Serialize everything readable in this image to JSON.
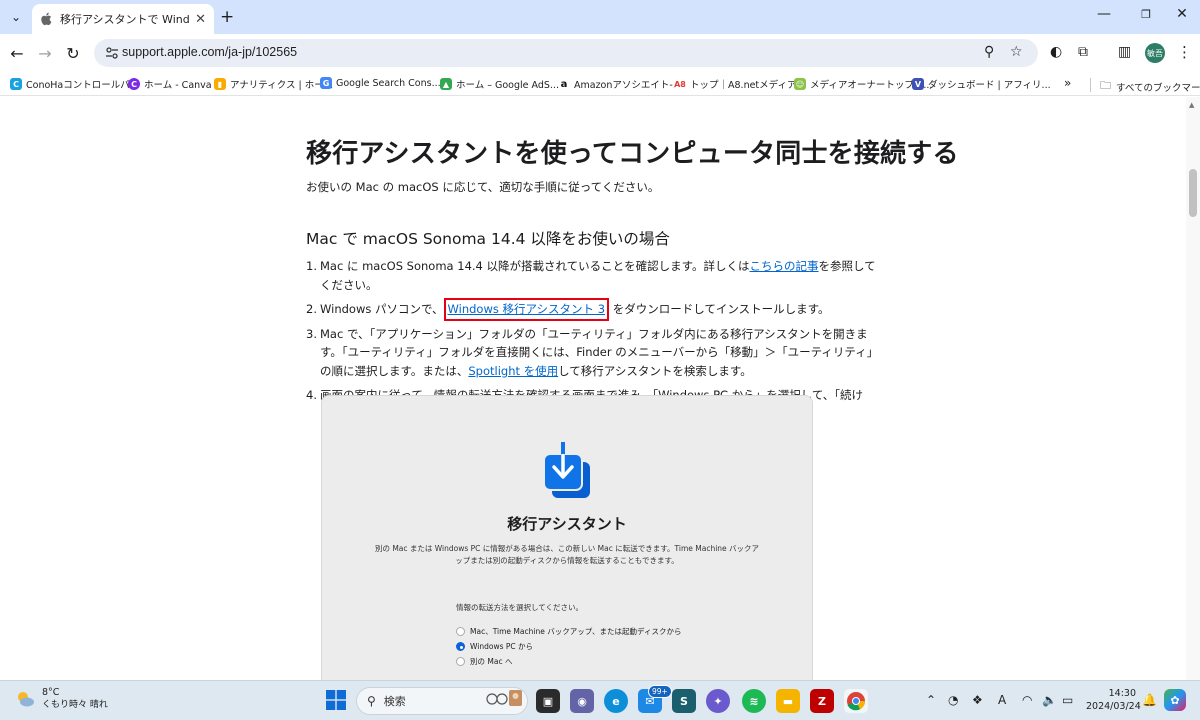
{
  "browser": {
    "tab_title": "移行アシスタントで Windows パソコン",
    "url": "support.apple.com/ja-jp/102565",
    "profile_label": "敏吾",
    "bookmarks": [
      {
        "label": "ConoHaコントロールパ...",
        "color": "#19a1e0"
      },
      {
        "label": "ホーム - Canva",
        "color": "#7d2ae8"
      },
      {
        "label": "アナリティクス | ホーム",
        "color": "#f9ab00"
      },
      {
        "label": "Google Search Cons...",
        "color": "#4285f4"
      },
      {
        "label": "ホーム – Google AdS...",
        "color": "#34a853"
      },
      {
        "label": "Amazonアソシエイト-...",
        "color": "#111111"
      },
      {
        "label": "トップ｜A8.netメディア...",
        "color": "#e53935"
      },
      {
        "label": "メディアオーナートップペ...",
        "color": "#8bc34a"
      },
      {
        "label": "ダッシュボード | アフィリ...",
        "color": "#3f51b5"
      }
    ],
    "all_bookmarks": "すべてのブックマーク"
  },
  "article": {
    "title": "移行アシスタントを使ってコンピュータ同士を接続する",
    "intro": "お使いの Mac の macOS に応じて、適切な手順に従ってください。",
    "section_heading": "Mac で macOS Sonoma 14.4 以降をお使いの場合",
    "step1": {
      "num": "1.",
      "pre": "Mac に macOS Sonoma 14.4 以降が搭載されていることを確認します。詳しくは",
      "link": "こちらの記事",
      "post": "を参照してください。"
    },
    "step2": {
      "num": "2.",
      "pre": "Windows パソコンで、",
      "link": "Windows 移行アシスタント 3",
      "post": " をダウンロードしてインストールします。"
    },
    "step3": {
      "num": "3.",
      "pre": "Mac で、「アプリケーション」フォルダの「ユーティリティ」フォルダ内にある移行アシスタントを開きます。「ユーティリティ」フォルダを直接開くには、Finder のメニューバーから「移動」＞「ユーティリティ」の順に選択します。または、",
      "link": "Spotlight を使用",
      "post": "して移行アシスタントを検索します。"
    },
    "step4": {
      "num": "4.",
      "text": "画面の案内に従って、情報の転送方法を確認する画面まで進み、「Windows PC から」を選択して、「続ける」をクリックします。"
    }
  },
  "migration_window": {
    "title": "移行アシスタント",
    "description": "別の Mac または Windows PC に情報がある場合は、この新しい Mac に転送できます。Time Machine バックアップまたは別の起動ディスクから情報を転送することもできます。",
    "question": "情報の転送方法を選択してください。",
    "options": [
      {
        "label": "Mac、Time Machine バックアップ、または起動ディスクから",
        "selected": false
      },
      {
        "label": "Windows PC から",
        "selected": true
      },
      {
        "label": "別の Mac へ",
        "selected": false
      }
    ]
  },
  "taskbar": {
    "weather_temp": "8°C",
    "weather_desc": "くもり時々 晴れ",
    "search_placeholder": "検索",
    "mail_badge": "99+",
    "time": "14:30",
    "date": "2024/03/24",
    "ime_indicator": "A"
  }
}
